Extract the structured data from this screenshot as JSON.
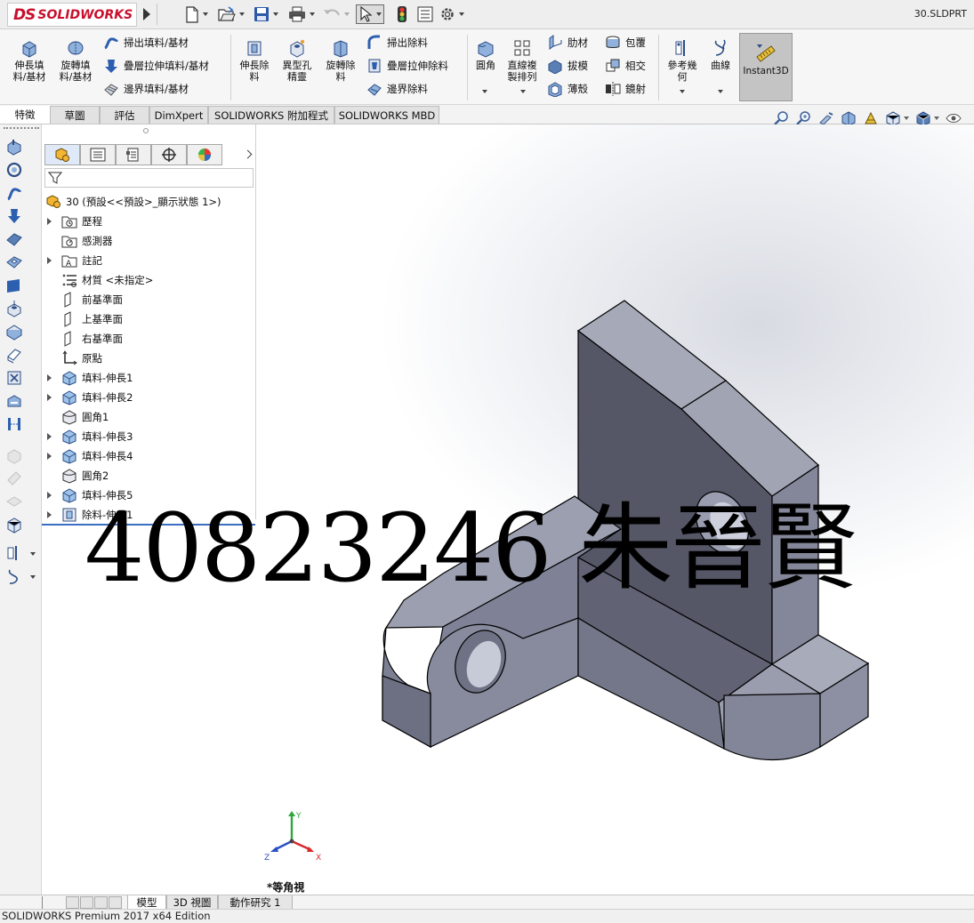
{
  "app": {
    "brand_mark": "DS",
    "brand_name": "SOLIDWORKS",
    "document_title": "30.SLDPRT"
  },
  "quick_access": [
    {
      "name": "new-document",
      "icon": "blank-page-icon"
    },
    {
      "name": "open-document",
      "icon": "open-folder-icon"
    },
    {
      "name": "save",
      "icon": "floppy-disk-icon"
    },
    {
      "name": "print",
      "icon": "printer-icon"
    },
    {
      "name": "undo",
      "icon": "undo-arrow-icon"
    },
    {
      "name": "select",
      "icon": "cursor-arrow-icon"
    },
    {
      "name": "rebuild",
      "icon": "traffic-light-icon"
    },
    {
      "name": "file-properties",
      "icon": "list-sheet-icon"
    },
    {
      "name": "options",
      "icon": "gear-icon"
    }
  ],
  "ribbon": {
    "extruded_boss": "伸長填\n料/基材",
    "revolved_boss": "旋轉填\n料/基材",
    "swept_boss": "掃出填料/基材",
    "lofted_boss": "疊層拉伸填料/基材",
    "boundary_boss": "邊界填料/基材",
    "extruded_cut": "伸長除\n料",
    "hole_wizard": "異型孔\n精靈",
    "revolved_cut": "旋轉除\n料",
    "swept_cut": "掃出除料",
    "lofted_cut": "疊層拉伸除料",
    "boundary_cut": "邊界除料",
    "fillet": "圓角",
    "linear_pattern": "直線複\n製排列",
    "rib": "肋材",
    "draft": "拔模",
    "shell": "薄殼",
    "wrap": "包覆",
    "intersect": "相交",
    "mirror": "鏡射",
    "reference_geometry": "參考幾\n何",
    "curves": "曲線",
    "instant3d": "Instant3D"
  },
  "command_tabs": [
    {
      "label": "特徵",
      "active": true
    },
    {
      "label": "草圖",
      "active": false
    },
    {
      "label": "評估",
      "active": false
    },
    {
      "label": "DimXpert",
      "active": false
    },
    {
      "label": "SOLIDWORKS 附加程式",
      "active": false
    },
    {
      "label": "SOLIDWORKS MBD",
      "active": false
    }
  ],
  "feature_tree": {
    "root": "30  (預設<<預設>_顯示狀態 1>)",
    "items": [
      {
        "label": "歷程",
        "icon": "history-folder-icon",
        "expandable": true
      },
      {
        "label": "感測器",
        "icon": "sensor-icon",
        "expandable": false
      },
      {
        "label": "註記",
        "icon": "annotation-icon",
        "expandable": true
      },
      {
        "label": "材質 <未指定>",
        "icon": "material-icon",
        "expandable": false
      },
      {
        "label": "前基準面",
        "icon": "plane-icon",
        "expandable": false
      },
      {
        "label": "上基準面",
        "icon": "plane-icon",
        "expandable": false
      },
      {
        "label": "右基準面",
        "icon": "plane-icon",
        "expandable": false
      },
      {
        "label": "原點",
        "icon": "origin-icon",
        "expandable": false
      },
      {
        "label": "填料-伸長1",
        "icon": "extrude-boss-icon",
        "expandable": true
      },
      {
        "label": "填料-伸長2",
        "icon": "extrude-boss-icon",
        "expandable": true
      },
      {
        "label": "圓角1",
        "icon": "fillet-icon",
        "expandable": false
      },
      {
        "label": "填料-伸長3",
        "icon": "extrude-boss-icon",
        "expandable": true
      },
      {
        "label": "填料-伸長4",
        "icon": "extrude-boss-icon",
        "expandable": true
      },
      {
        "label": "圓角2",
        "icon": "fillet-icon",
        "expandable": false
      },
      {
        "label": "填料-伸長5",
        "icon": "extrude-boss-icon",
        "expandable": true
      },
      {
        "label": "除料-伸長1",
        "icon": "extrude-cut-icon",
        "expandable": true
      }
    ]
  },
  "viewport": {
    "view_name": "*等角視",
    "triad": {
      "x": "X",
      "y": "Y",
      "z": "Z"
    },
    "watermark": "40823246 朱晉賢"
  },
  "bottom_tabs": [
    {
      "label": "模型",
      "active": true
    },
    {
      "label": "3D 視圖",
      "active": false
    },
    {
      "label": "動作研究 1",
      "active": false
    }
  ],
  "status": {
    "text": "SOLIDWORKS Premium 2017 x64 Edition"
  },
  "colors": {
    "brand_red": "#c8102e",
    "accent_blue": "#2f6fc4",
    "part_face_light": "#a4a7b6",
    "part_face_mid": "#86899b",
    "part_face_dark": "#535566"
  }
}
